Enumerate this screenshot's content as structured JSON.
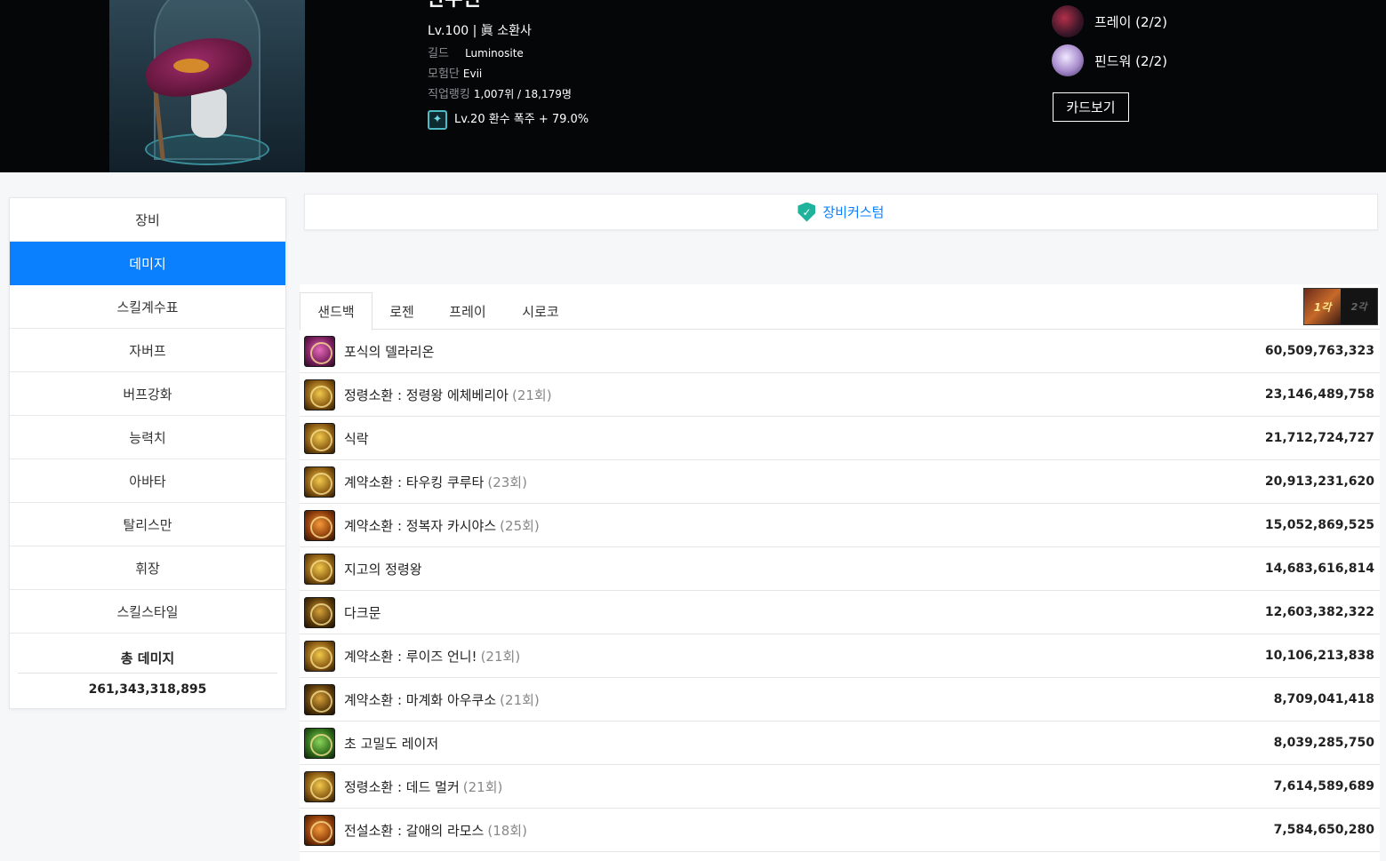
{
  "header": {
    "character_name": "란주린",
    "level_class": "Lv.100 | 眞 소환사",
    "guild_label": "길드",
    "guild_value": "Luminosite",
    "adventure_label": "모험단",
    "adventure_value": "Evii",
    "rank_label": "직업랭킹",
    "rank_value": "1,007위 / 18,179명",
    "buff_text": "Lv.20 환수 폭주 + 79.0%",
    "set_items": [
      {
        "label": "프레이 (2/2)"
      },
      {
        "label": "핀드워 (2/2)"
      }
    ],
    "card_button": "카드보기"
  },
  "sidebar": {
    "items": [
      {
        "label": "장비"
      },
      {
        "label": "데미지"
      },
      {
        "label": "스킬계수표"
      },
      {
        "label": "자버프"
      },
      {
        "label": "버프강화"
      },
      {
        "label": "능력치"
      },
      {
        "label": "아바타"
      },
      {
        "label": "탈리스만"
      },
      {
        "label": "휘장"
      },
      {
        "label": "스킬스타일"
      }
    ],
    "active_index": 1,
    "total_title": "총 데미지",
    "total_value": "261,343,318,895"
  },
  "custom_bar": {
    "label": "장비커스텀"
  },
  "tabs": [
    {
      "label": "샌드백"
    },
    {
      "label": "로젠"
    },
    {
      "label": "프레이"
    },
    {
      "label": "시로코"
    }
  ],
  "rank_thumb": {
    "first": "1각",
    "second": "2각"
  },
  "skills": [
    {
      "name": "포식의 델라리온",
      "count": "",
      "value": "60,509,763,323",
      "icon": "pink"
    },
    {
      "name": "정령소환 : 정령왕 에체베리아",
      "count": "(21회)",
      "value": "23,146,489,758",
      "icon": "gold"
    },
    {
      "name": "식락",
      "count": "",
      "value": "21,712,724,727",
      "icon": "gold"
    },
    {
      "name": "계약소환 : 타우킹 쿠루타",
      "count": "(23회)",
      "value": "20,913,231,620",
      "icon": "gold"
    },
    {
      "name": "계약소환 : 정복자 카시야스",
      "count": "(25회)",
      "value": "15,052,869,525",
      "icon": "orange"
    },
    {
      "name": "지고의 정령왕",
      "count": "",
      "value": "14,683,616,814",
      "icon": "gold"
    },
    {
      "name": "다크문",
      "count": "",
      "value": "12,603,382,322",
      "icon": "darkgold"
    },
    {
      "name": "계약소환 : 루이즈 언니!",
      "count": "(21회)",
      "value": "10,106,213,838",
      "icon": "gold"
    },
    {
      "name": "계약소환 : 마계화 아우쿠소",
      "count": "(21회)",
      "value": "8,709,041,418",
      "icon": "darkgold"
    },
    {
      "name": "초 고밀도 레이저",
      "count": "",
      "value": "8,039,285,750",
      "icon": "green"
    },
    {
      "name": "정령소환 : 데드 멀커",
      "count": "(21회)",
      "value": "7,614,589,689",
      "icon": "gold"
    },
    {
      "name": "전설소환 : 갈애의 라모스",
      "count": "(18회)",
      "value": "7,584,650,280",
      "icon": "orange"
    }
  ]
}
